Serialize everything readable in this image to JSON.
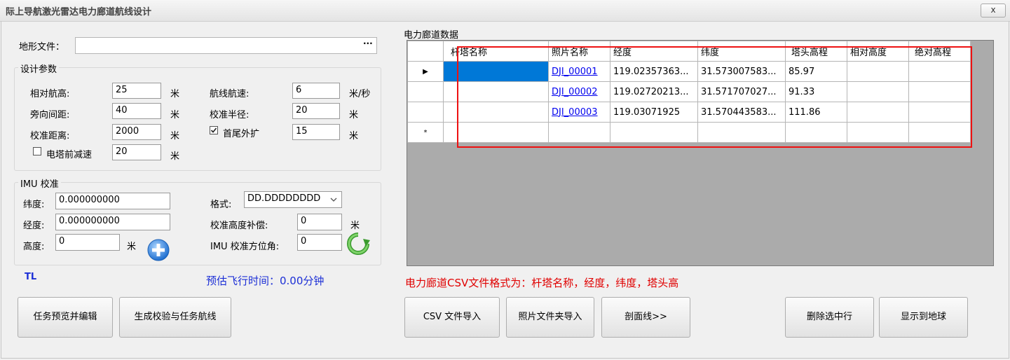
{
  "window": {
    "title": "际上导航激光雷达电力廊道航线设计",
    "close_glyph": "x"
  },
  "terrain": {
    "label": "地形文件：",
    "value": "",
    "browse_label": "···"
  },
  "design": {
    "legend": "设计参数",
    "rel_alt_label": "相对航高:",
    "rel_alt_value": "25",
    "rel_alt_unit": "米",
    "side_spacing_label": "旁向间距:",
    "side_spacing_value": "40",
    "side_spacing_unit": "米",
    "calib_dist_label": "校准距离:",
    "calib_dist_value": "2000",
    "calib_dist_unit": "米",
    "tower_slow_label": "电塔前减速",
    "tower_slow_checked": false,
    "tower_slow_value": "20",
    "tower_slow_unit": "米",
    "speed_label": "航线航速:",
    "speed_value": "6",
    "speed_unit": "米/秒",
    "calib_radius_label": "校准半径:",
    "calib_radius_value": "20",
    "calib_radius_unit": "米",
    "ext_label": "首尾外扩",
    "ext_checked": true,
    "ext_value": "15",
    "ext_unit": "米"
  },
  "imu": {
    "legend": "IMU 校准",
    "lat_label": "纬度:",
    "lat_value": "0.000000000",
    "lon_label": "经度:",
    "lon_value": "0.000000000",
    "height_label": "高度:",
    "height_value": "0",
    "height_unit": "米",
    "format_label": "格式:",
    "format_value": "DD.DDDDDDDD",
    "calib_height_label": "校准高度补偿:",
    "calib_height_value": "0",
    "calib_height_unit": "米",
    "azimuth_label": "IMU 校准方位角:",
    "azimuth_value": "0"
  },
  "status": {
    "tl": "TL",
    "flight_time": "预估飞行时间：0.00分钟"
  },
  "left_buttons": {
    "preview": "任务预览并编辑",
    "generate": "生成校验与任务航线"
  },
  "corridor": {
    "title": "电力廊道数据",
    "columns": [
      "杆塔名称",
      "照片名称",
      "经度",
      "纬度",
      "塔头高程",
      "相对高度",
      "绝对高程"
    ],
    "rows": [
      {
        "tower": "",
        "photo": "DJI_00001",
        "lon": "119.02357363...",
        "lat": "31.573007583...",
        "head": "85.97",
        "rel": "",
        "abs": ""
      },
      {
        "tower": "",
        "photo": "DJI_00002",
        "lon": "119.02720213...",
        "lat": "31.571707027...",
        "head": "91.33",
        "rel": "",
        "abs": ""
      },
      {
        "tower": "",
        "photo": "DJI_00003",
        "lon": "119.03071925",
        "lat": "31.570443583...",
        "head": "111.86",
        "rel": "",
        "abs": ""
      }
    ],
    "current_row_glyph": "▶",
    "new_row_glyph": "*",
    "hint": "电力廊道CSV文件格式为：杆塔名称，经度，纬度，塔头高"
  },
  "right_buttons": {
    "csv_import": "CSV 文件导入",
    "photo_import": "照片文件夹导入",
    "profile": "剖面线>>",
    "delete": "删除选中行",
    "show_globe": "显示到地球"
  },
  "colors": {
    "highlight_box": "#e11111",
    "selection": "#0078d7",
    "hint_text": "#e00000",
    "status_text": "#1c2fd6",
    "grid_background": "#ababab"
  },
  "icons": {
    "add": "plus-circle-icon",
    "refresh": "refresh-arrow-icon",
    "dropdown": "chevron-down-icon"
  }
}
